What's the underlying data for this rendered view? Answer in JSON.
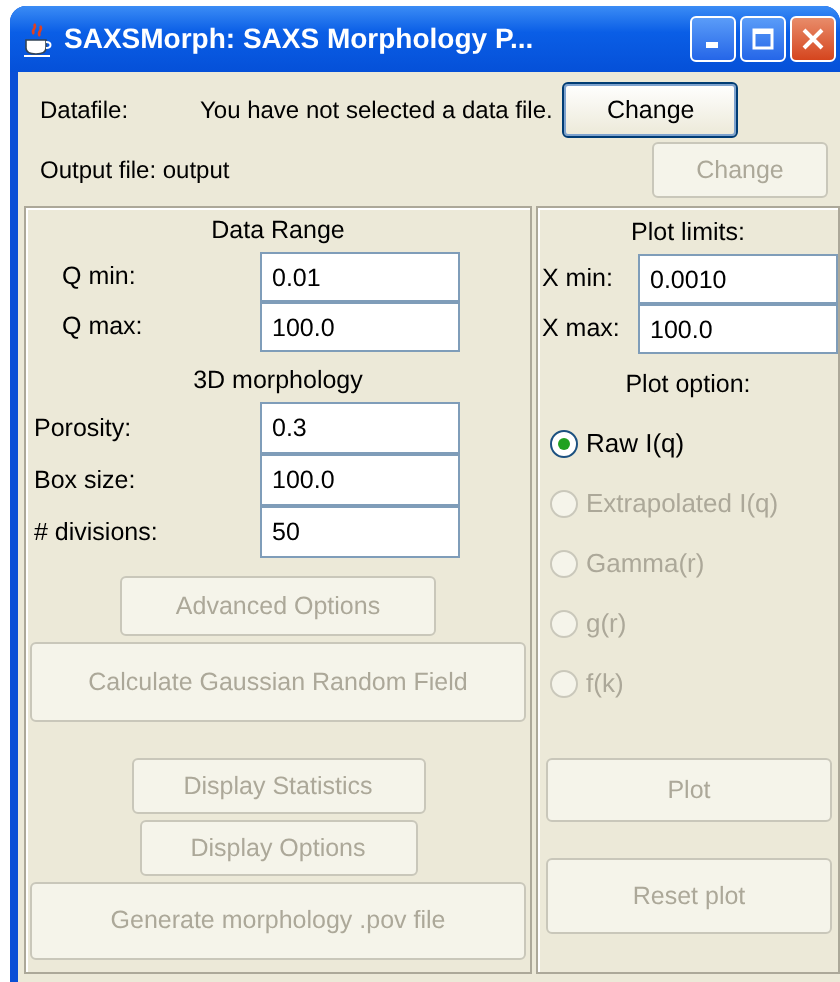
{
  "window": {
    "title": "SAXSMorph: SAXS Morphology P..."
  },
  "datafile": {
    "label": "Datafile:",
    "value": "You have not selected a data file.",
    "button": {
      "label": "Change",
      "disabled": false
    }
  },
  "output_file": {
    "label": "Output file: output",
    "button": {
      "label": "Change",
      "disabled": true
    }
  },
  "data_range": {
    "title": "Data Range",
    "fields": [
      {
        "label": "Q min:",
        "value": "0.01"
      },
      {
        "label": "Q max:",
        "value": "100.0"
      }
    ]
  },
  "morphology": {
    "title": "3D morphology",
    "fields": [
      {
        "label": "Porosity:",
        "value": "0.3"
      },
      {
        "label": "Box size:",
        "value": "100.0"
      },
      {
        "label": "# divisions:",
        "value": "50"
      }
    ]
  },
  "left_buttons": [
    {
      "label": "Advanced Options",
      "disabled": true,
      "kind": "narrow"
    },
    {
      "label": "Calculate Gaussian Random Field",
      "disabled": true,
      "kind": "wide"
    },
    {
      "label": "Display Statistics",
      "disabled": true,
      "kind": "narrow"
    },
    {
      "label": "Display Options",
      "disabled": true,
      "kind": "narrow"
    },
    {
      "label": "Generate morphology .pov file",
      "disabled": true,
      "kind": "wide"
    }
  ],
  "plot_limits": {
    "title": "Plot limits:",
    "fields": [
      {
        "label": "X min:",
        "value": "0.0010"
      },
      {
        "label": "X max:",
        "value": "100.0"
      }
    ]
  },
  "plot_option": {
    "title": "Plot option:",
    "options": [
      {
        "label": "Raw I(q)",
        "selected": true,
        "disabled": false
      },
      {
        "label": "Extrapolated I(q)",
        "selected": false,
        "disabled": true
      },
      {
        "label": "Gamma(r)",
        "selected": false,
        "disabled": true
      },
      {
        "label": "g(r)",
        "selected": false,
        "disabled": true
      },
      {
        "label": "f(k)",
        "selected": false,
        "disabled": true
      }
    ]
  },
  "right_buttons": [
    {
      "label": "Plot",
      "disabled": true
    },
    {
      "label": "Reset plot",
      "disabled": true
    }
  ]
}
